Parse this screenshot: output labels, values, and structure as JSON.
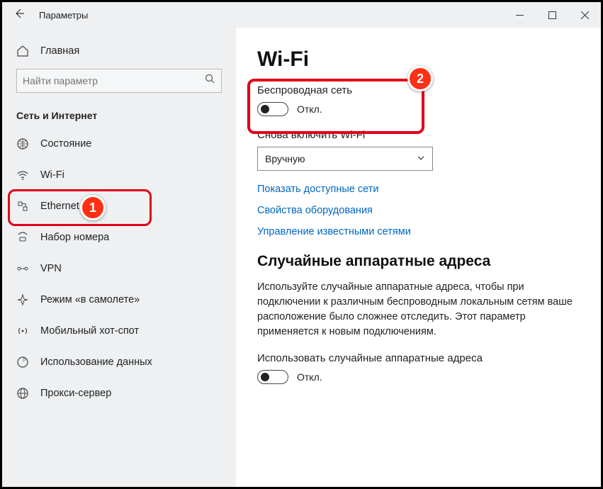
{
  "titlebar": {
    "title": "Параметры"
  },
  "sidebar": {
    "home": "Главная",
    "search_placeholder": "Найти параметр",
    "section": "Сеть и Интернет",
    "items": [
      {
        "label": "Состояние"
      },
      {
        "label": "Wi-Fi"
      },
      {
        "label": "Ethernet"
      },
      {
        "label": "Набор номера"
      },
      {
        "label": "VPN"
      },
      {
        "label": "Режим «в самолете»"
      },
      {
        "label": "Мобильный хот-спот"
      },
      {
        "label": "Использование данных"
      },
      {
        "label": "Прокси-сервер"
      }
    ]
  },
  "main": {
    "heading": "Wi-Fi",
    "wireless": {
      "title": "Беспроводная сеть",
      "state": "Откл."
    },
    "reenable": {
      "title": "Снова включить Wi-Fi",
      "value": "Вручную"
    },
    "links": {
      "show_networks": "Показать доступные сети",
      "hw_props": "Свойства оборудования",
      "manage_known": "Управление известными сетями"
    },
    "random_hw": {
      "heading": "Случайные аппаратные адреса",
      "desc": "Используйте случайные аппаратные адреса, чтобы при подключении к различным беспроводным локальным сетям ваше расположение было сложнее отследить. Этот параметр применяется к новым подключениям.",
      "toggle_title": "Использовать случайные аппаратные адреса",
      "state": "Откл."
    }
  },
  "annotations": {
    "b1": "1",
    "b2": "2"
  }
}
